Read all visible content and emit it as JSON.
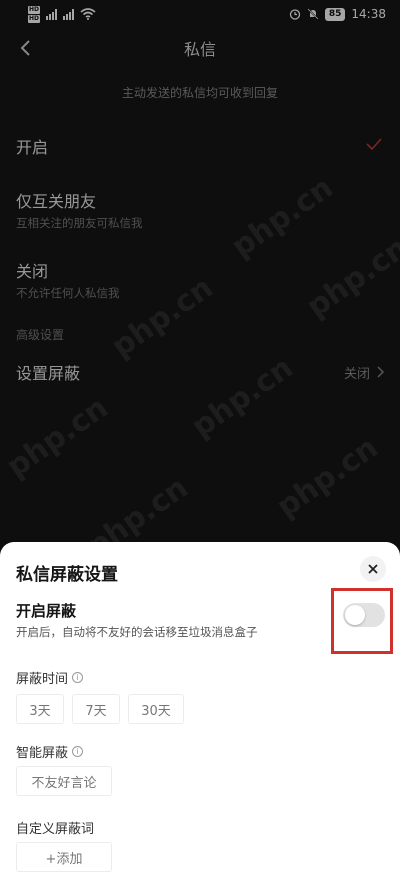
{
  "status": {
    "time": "14:38",
    "battery": "85"
  },
  "header": {
    "title": "私信"
  },
  "hint": "主动发送的私信均可收到回复",
  "options": [
    {
      "label": "开启",
      "desc": ""
    },
    {
      "label": "仅互关朋友",
      "desc": "互相关注的朋友可私信我"
    },
    {
      "label": "关闭",
      "desc": "不允许任何人私信我"
    }
  ],
  "advanced": {
    "section_label": "高级设置",
    "shield_label": "设置屏蔽",
    "shield_value": "关闭"
  },
  "watermark": "php.cn",
  "sheet": {
    "title": "私信屏蔽设置",
    "enable_title": "开启屏蔽",
    "enable_desc": "开启后，自动将不友好的会话移至垃圾消息盒子",
    "toggle_on": false,
    "time_label": "屏蔽时间",
    "time_options": [
      "3天",
      "7天",
      "30天"
    ],
    "smart_label": "智能屏蔽",
    "smart_options": [
      "不友好言论"
    ],
    "custom_label": "自定义屏蔽词",
    "add_label": "+添加"
  },
  "colors": {
    "accent": "#d0312d",
    "sheet_bg": "#ffffff",
    "page_bg": "#161616"
  }
}
